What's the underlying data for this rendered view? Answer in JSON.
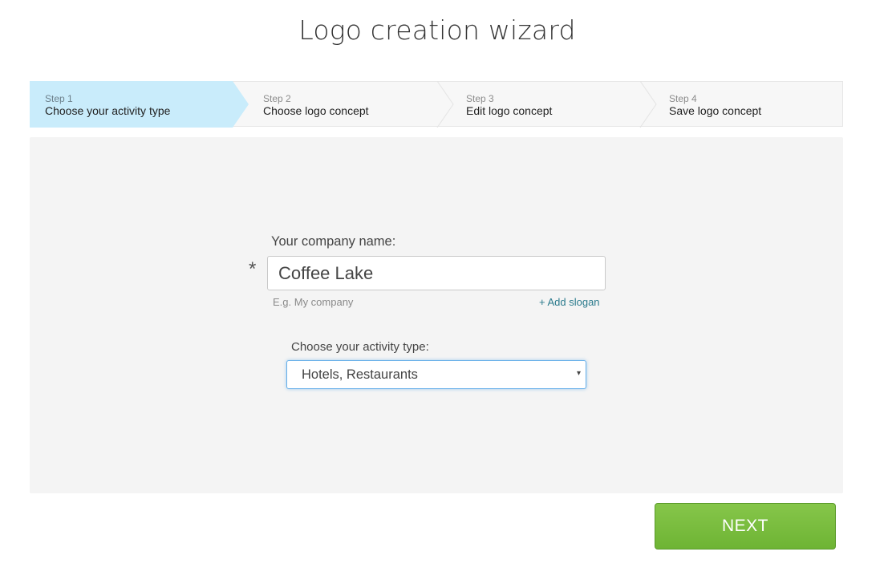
{
  "title": "Logo creation wizard",
  "steps": [
    {
      "num": "Step 1",
      "label": "Choose your activity type",
      "active": true
    },
    {
      "num": "Step 2",
      "label": "Choose logo concept",
      "active": false
    },
    {
      "num": "Step 3",
      "label": "Edit logo concept",
      "active": false
    },
    {
      "num": "Step 4",
      "label": "Save logo concept",
      "active": false
    }
  ],
  "form": {
    "company_label": "Your company name:",
    "required_mark": "*",
    "company_value": "Coffee Lake",
    "company_hint": "E.g. My company",
    "add_slogan": "+ Add slogan",
    "activity_label": "Choose your activity type:",
    "activity_value": "Hotels, Restaurants",
    "dropdown_icon": "▾"
  },
  "next_label": "NEXT",
  "colors": {
    "active_step_bg": "#c9ecfb",
    "next_button": "#76bc3a",
    "link": "#2a7a8c"
  }
}
